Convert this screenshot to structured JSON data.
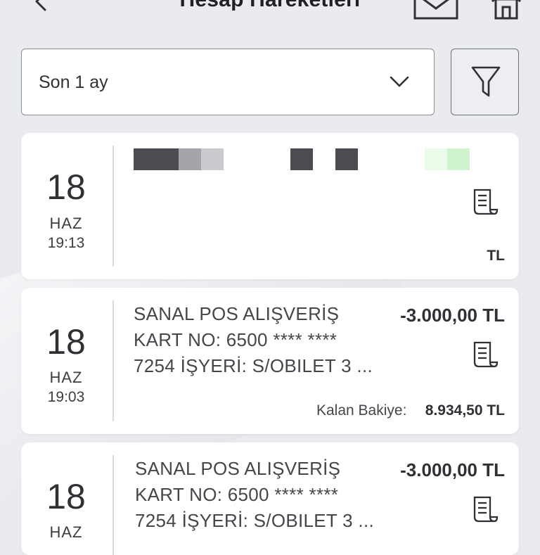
{
  "header": {
    "title": "Hesap Hareketleri"
  },
  "filter": {
    "period": "Son 1 ay"
  },
  "transactions": [
    {
      "day": "18",
      "month": "HAZ",
      "time": "19:13",
      "currency": "TL"
    },
    {
      "day": "18",
      "month": "HAZ",
      "time": "19:03",
      "lines": [
        "SANAL POS ALIŞVERİŞ",
        "KART NO: 6500 **** ****",
        "7254 İŞYERİ: S/OBILET 3  ..."
      ],
      "amount": "-3.000,00 TL",
      "balance_label": "Kalan Bakiye:",
      "balance": "8.934,50 TL"
    },
    {
      "day": "18",
      "month": "HAZ",
      "lines": [
        "SANAL POS ALIŞVERİŞ",
        "KART NO: 6500 **** ****",
        "7254 İŞYERİ: S/OBILET 3  ..."
      ],
      "amount": "-3.000,00 TL"
    }
  ],
  "colors": {
    "background": "#e9ebef",
    "card": "#ffffff",
    "text": "#2f3136",
    "border": "#8a8d93"
  },
  "icons": [
    "back-icon",
    "mail-icon",
    "home-icon",
    "chevron-down-icon",
    "filter-icon",
    "receipt-icon"
  ]
}
